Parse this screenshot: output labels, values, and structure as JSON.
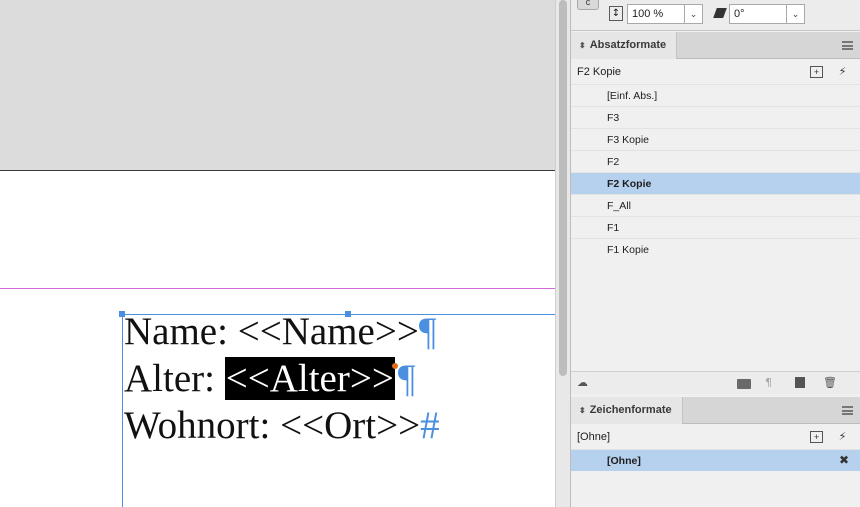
{
  "document": {
    "lines": [
      {
        "prefix": "Name: ",
        "field": "<<Name>>",
        "mark": "¶"
      },
      {
        "prefix": "Alter: ",
        "field": "<<Alter>>",
        "mark": "¶"
      },
      {
        "prefix": "Wohnort: ",
        "field": "<<Ort>>",
        "mark": "#"
      }
    ]
  },
  "controls": {
    "c_button": "c",
    "scale_icon": "↕",
    "scale_value": "100 %",
    "angle_value": "0°"
  },
  "paragraph_styles": {
    "title": "Absatzformate",
    "current": "F2 Kopie",
    "items": [
      {
        "label": "[Einf. Abs.]",
        "selected": false
      },
      {
        "label": "F3",
        "selected": false
      },
      {
        "label": "F3 Kopie",
        "selected": false
      },
      {
        "label": "F2",
        "selected": false
      },
      {
        "label": "F2 Kopie",
        "selected": true
      },
      {
        "label": "F_All",
        "selected": false
      },
      {
        "label": "F1",
        "selected": false
      },
      {
        "label": "F1 Kopie",
        "selected": false
      }
    ],
    "footer_icons": [
      "cloud-icon",
      "folder-icon",
      "clear-overrides-icon",
      "new-style-icon",
      "trash-icon"
    ]
  },
  "character_styles": {
    "title": "Zeichenformate",
    "current": "[Ohne]",
    "items": [
      {
        "label": "[Ohne]",
        "selected": true
      }
    ]
  },
  "icons": {
    "panel_arrows": "⌃⌄",
    "new_style": "+",
    "quick_apply": "⚡",
    "clear": "✖"
  },
  "colors": {
    "selection": "#b6d1ee",
    "frame": "#4a8fe0",
    "margin": "#d36ad8"
  }
}
